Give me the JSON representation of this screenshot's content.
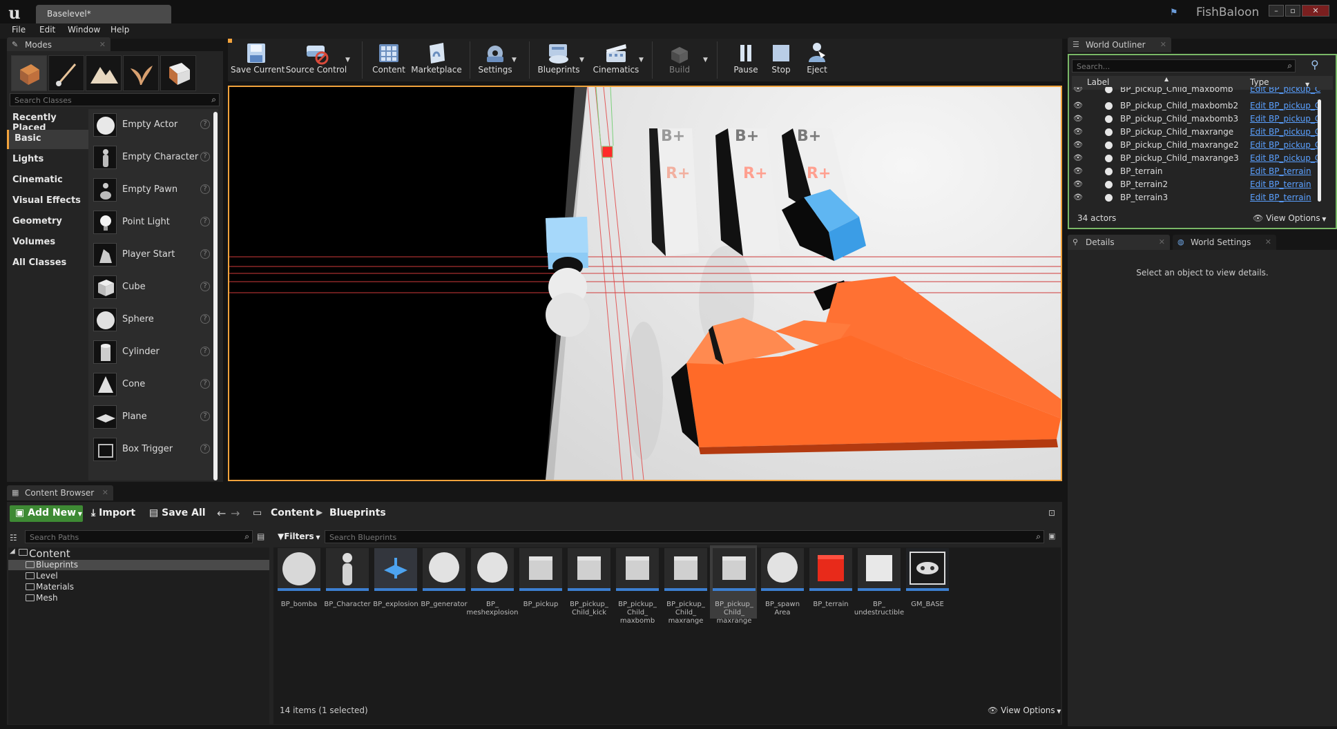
{
  "title_bar": {
    "document_tab": "Baselevel*",
    "project_name": "FishBaloon",
    "window_buttons": [
      "–",
      "▫",
      "✕"
    ]
  },
  "menu": [
    "File",
    "Edit",
    "Window",
    "Help"
  ],
  "modes": {
    "tab_label": "Modes",
    "search_placeholder": "Search Classes",
    "categories": [
      "Recently Placed",
      "Basic",
      "Lights",
      "Cinematic",
      "Visual Effects",
      "Geometry",
      "Volumes",
      "All Classes"
    ],
    "active_category": "Basic",
    "items": [
      {
        "label": "Empty Actor",
        "icon": "sphere-icon"
      },
      {
        "label": "Empty Character",
        "icon": "character-icon"
      },
      {
        "label": "Empty Pawn",
        "icon": "pawn-icon"
      },
      {
        "label": "Point Light",
        "icon": "lightbulb-icon"
      },
      {
        "label": "Player Start",
        "icon": "player-start-icon"
      },
      {
        "label": "Cube",
        "icon": "cube-icon"
      },
      {
        "label": "Sphere",
        "icon": "sphere-icon"
      },
      {
        "label": "Cylinder",
        "icon": "cylinder-icon"
      },
      {
        "label": "Cone",
        "icon": "cone-icon"
      },
      {
        "label": "Plane",
        "icon": "plane-icon"
      },
      {
        "label": "Box Trigger",
        "icon": "box-trigger-icon"
      }
    ],
    "help_glyph": "?"
  },
  "toolbar": {
    "buttons": [
      {
        "label": "Save Current",
        "icon": "save-icon"
      },
      {
        "label": "Source Control",
        "icon": "source-control-icon"
      },
      {
        "label": "Content",
        "icon": "content-icon"
      },
      {
        "label": "Marketplace",
        "icon": "marketplace-icon"
      },
      {
        "label": "Settings",
        "icon": "settings-icon"
      },
      {
        "label": "Blueprints",
        "icon": "blueprints-icon"
      },
      {
        "label": "Cinematics",
        "icon": "cinematics-icon"
      },
      {
        "label": "Build",
        "icon": "build-icon"
      },
      {
        "label": "Pause",
        "icon": "pause-icon"
      },
      {
        "label": "Stop",
        "icon": "stop-icon"
      },
      {
        "label": "Eject",
        "icon": "eject-icon"
      }
    ]
  },
  "viewport": {
    "pickup_labels": [
      "B+",
      "R+"
    ]
  },
  "outliner": {
    "tab_label": "World Outliner",
    "search_placeholder": "Search...",
    "col_label": "Label",
    "col_type": "Type",
    "rows": [
      {
        "label": "BP_pickup_Child_maxbomb",
        "type": "Edit BP_pickup_C"
      },
      {
        "label": "BP_pickup_Child_maxbomb2",
        "type": "Edit BP_pickup_C"
      },
      {
        "label": "BP_pickup_Child_maxbomb3",
        "type": "Edit BP_pickup_C"
      },
      {
        "label": "BP_pickup_Child_maxrange",
        "type": "Edit BP_pickup_C"
      },
      {
        "label": "BP_pickup_Child_maxrange2",
        "type": "Edit BP_pickup_C"
      },
      {
        "label": "BP_pickup_Child_maxrange3",
        "type": "Edit BP_pickup_C"
      },
      {
        "label": "BP_terrain",
        "type": "Edit BP_terrain"
      },
      {
        "label": "BP_terrain2",
        "type": "Edit BP_terrain"
      },
      {
        "label": "BP_terrain3",
        "type": "Edit BP_terrain"
      }
    ],
    "actor_count": "34 actors",
    "view_options": "View Options"
  },
  "details": {
    "tab_details": "Details",
    "tab_world_settings": "World Settings",
    "empty_message": "Select an object to view details."
  },
  "content_browser": {
    "tab_label": "Content Browser",
    "add_new": "Add New",
    "import": "Import",
    "save_all": "Save All",
    "path": [
      "Content",
      "Blueprints"
    ],
    "search_paths_placeholder": "Search Paths",
    "filters": "Filters",
    "search_placeholder": "Search Blueprints",
    "tree": {
      "root": "Content",
      "folders": [
        "Blueprints",
        "Level",
        "Materials",
        "Mesh"
      ],
      "selected": "Blueprints"
    },
    "assets": [
      {
        "name": "BP_bomba",
        "thumb": "sphere"
      },
      {
        "name": "BP_Character",
        "thumb": "character"
      },
      {
        "name": "BP_explosion",
        "thumb": "explosion"
      },
      {
        "name": "BP_generator",
        "thumb": "sphere"
      },
      {
        "name": "BP_\nmeshexplosion",
        "thumb": "sphere"
      },
      {
        "name": "BP_pickup",
        "thumb": "cube"
      },
      {
        "name": "BP_pickup_\nChild_kick",
        "thumb": "cube"
      },
      {
        "name": "BP_pickup_\nChild_\nmaxbomb",
        "thumb": "cube"
      },
      {
        "name": "BP_pickup_\nChild_\nmaxrange",
        "thumb": "cube"
      },
      {
        "name": "BP_pickup_\nChild_\nmaxrange",
        "thumb": "cube",
        "selected": true
      },
      {
        "name": "BP_spawn\nArea",
        "thumb": "sphere"
      },
      {
        "name": "BP_terrain",
        "thumb": "red-cube"
      },
      {
        "name": "BP_\nundestructible",
        "thumb": "cube"
      },
      {
        "name": "GM_BASE",
        "thumb": "gamepad"
      }
    ],
    "status": "14 items (1 selected)",
    "view_options": "View Options"
  },
  "colors": {
    "accent_orange": "#f2a33c",
    "outliner_border": "#7ab867",
    "link_blue": "#5aa0ff",
    "add_new_green": "#3e8a34",
    "floor_orange": "#ff6a2a",
    "cube_blue": "#55b0f0"
  }
}
